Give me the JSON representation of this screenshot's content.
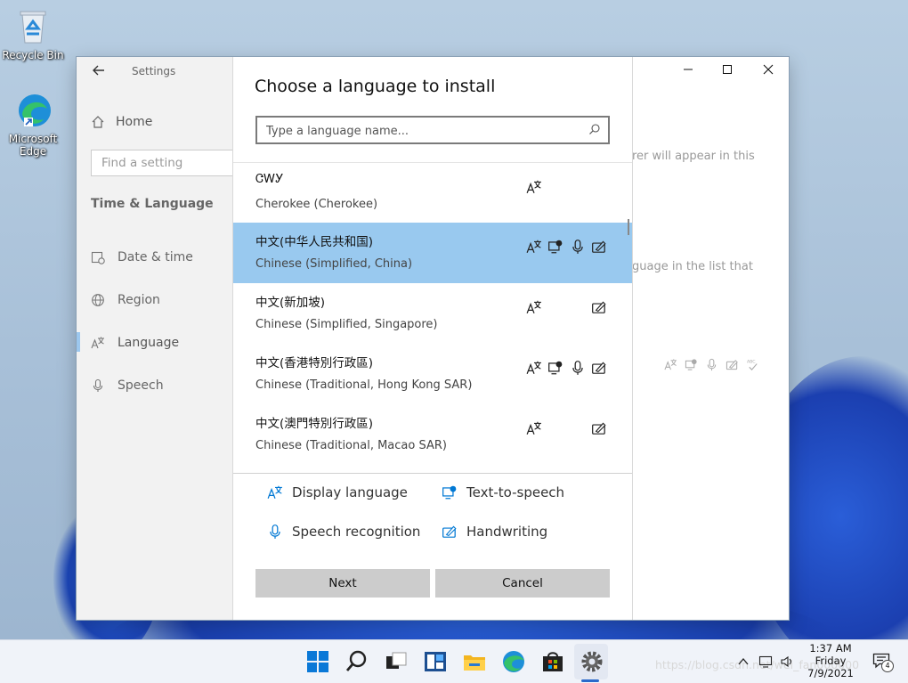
{
  "desktop": {
    "icons": [
      {
        "label": "Recycle Bin"
      },
      {
        "label": "Microsoft Edge"
      }
    ]
  },
  "settings": {
    "app_title": "Settings",
    "home_label": "Home",
    "find_placeholder": "Find a setting",
    "section_title": "Time & Language",
    "nav_items": [
      {
        "label": "Date & time",
        "icon": "calendar-clock-icon"
      },
      {
        "label": "Region",
        "icon": "globe-icon"
      },
      {
        "label": "Language",
        "icon": "language-icon"
      },
      {
        "label": "Speech",
        "icon": "microphone-icon"
      }
    ],
    "background_text": [
      "rer will appear in this",
      "guage in the list that"
    ]
  },
  "dialog": {
    "title": "Choose a language to install",
    "search_placeholder": "Type a language name...",
    "languages": [
      {
        "native": "ᏣᎳᎩ",
        "english": "Cherokee (Cherokee)",
        "features": [
          "display"
        ],
        "selected": false
      },
      {
        "native": "中文(中华人民共和国)",
        "english": "Chinese (Simplified, China)",
        "features": [
          "display",
          "tts",
          "speech",
          "handwriting"
        ],
        "selected": true
      },
      {
        "native": "中文(新加坡)",
        "english": "Chinese (Simplified, Singapore)",
        "features": [
          "display",
          "handwriting"
        ],
        "selected": false
      },
      {
        "native": "中文(香港特別行政區)",
        "english": "Chinese (Traditional, Hong Kong SAR)",
        "features": [
          "display",
          "tts",
          "speech",
          "handwriting"
        ],
        "selected": false
      },
      {
        "native": "中文(澳門特別行政區)",
        "english": "Chinese (Traditional, Macao SAR)",
        "features": [
          "display",
          "handwriting"
        ],
        "selected": false
      }
    ],
    "legend": {
      "display": "Display language",
      "tts": "Text-to-speech",
      "speech": "Speech recognition",
      "handwriting": "Handwriting"
    },
    "next_label": "Next",
    "cancel_label": "Cancel"
  },
  "taskbar": {
    "time": "1:37 AM",
    "day": "Friday",
    "date": "7/9/2021",
    "notification_count": "4",
    "watermark": "https://blog.csdn.net/wei_fan000000"
  },
  "colors": {
    "selection": "#99c9ef",
    "button": "#cccccc",
    "accent": "#0078d4"
  }
}
